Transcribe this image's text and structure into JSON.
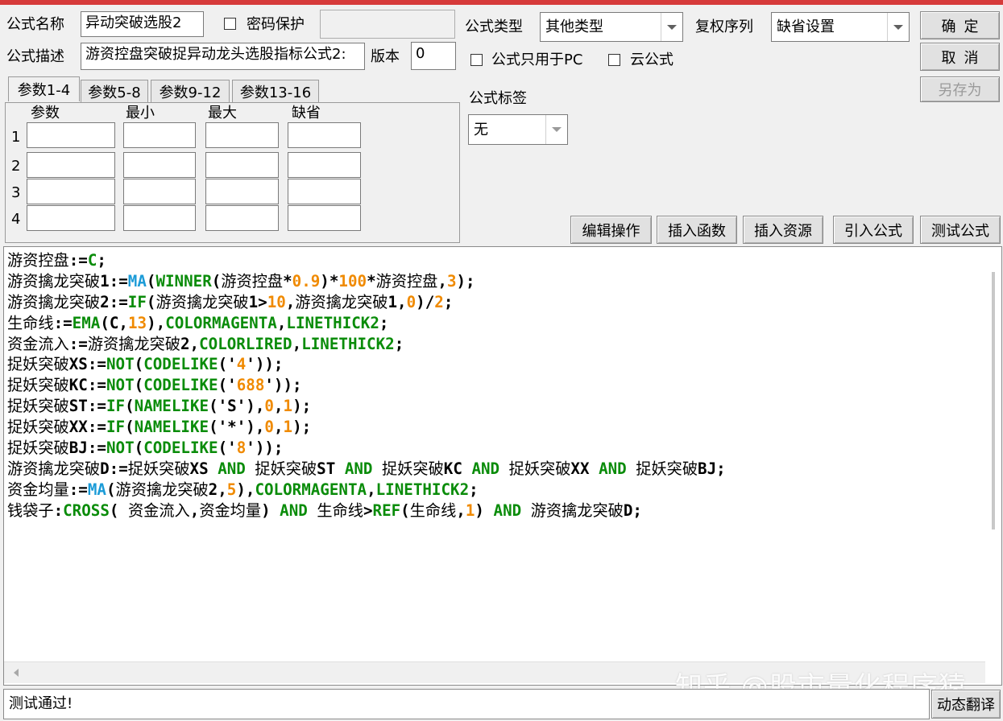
{
  "formula_name": {
    "label": "公式名称",
    "value": "异动突破选股2"
  },
  "password": {
    "label": "密码保护",
    "value": ""
  },
  "formula_type": {
    "label": "公式类型",
    "value": "其他类型"
  },
  "rights_seq": {
    "label": "复权序列",
    "value": "缺省设置"
  },
  "formula_desc": {
    "label": "公式描述",
    "value": "游资控盘突破捉异动龙头选股指标公式2:"
  },
  "version": {
    "label": "版本",
    "value": "0"
  },
  "pc_only": {
    "label": "公式只用于PC"
  },
  "cloud": {
    "label": "云公式"
  },
  "buttons": {
    "ok": "确定",
    "cancel": "取消",
    "save_as": "另存为",
    "edit_ops": "编辑操作",
    "insert_func": "插入函数",
    "insert_res": "插入资源",
    "import_formula": "引入公式",
    "test_formula": "测试公式",
    "dynamic_translate": "动态翻译"
  },
  "tabs": [
    "参数1-4",
    "参数5-8",
    "参数9-12",
    "参数13-16"
  ],
  "param_headers": [
    "参数",
    "最小",
    "最大",
    "缺省"
  ],
  "param_rows": [
    "1",
    "2",
    "3",
    "4"
  ],
  "tag": {
    "label": "公式标签",
    "value": "无"
  },
  "code_lines": [
    [
      [
        "v",
        "游资控盘"
      ],
      [
        "o",
        ":="
      ],
      [
        "f",
        "C"
      ],
      [
        "o",
        ";"
      ]
    ],
    [
      [
        "v",
        "游资擒龙突破"
      ],
      [
        "o",
        "1:="
      ],
      [
        "k",
        "MA"
      ],
      [
        "o",
        "("
      ],
      [
        "f",
        "WINNER"
      ],
      [
        "o",
        "("
      ],
      [
        "v",
        "游资控盘"
      ],
      [
        "o",
        "*"
      ],
      [
        "n",
        "0.9"
      ],
      [
        "o",
        ")*"
      ],
      [
        "n",
        "100"
      ],
      [
        "o",
        "*"
      ],
      [
        "v",
        "游资控盘"
      ],
      [
        "o",
        ","
      ],
      [
        "n",
        "3"
      ],
      [
        "o",
        ");"
      ]
    ],
    [
      [
        "v",
        "游资擒龙突破"
      ],
      [
        "o",
        "2:="
      ],
      [
        "f",
        "IF"
      ],
      [
        "o",
        "("
      ],
      [
        "v",
        "游资擒龙突破"
      ],
      [
        "o",
        "1>"
      ],
      [
        "n",
        "10"
      ],
      [
        "o",
        ","
      ],
      [
        "v",
        "游资擒龙突破"
      ],
      [
        "o",
        "1,"
      ],
      [
        "n",
        "0"
      ],
      [
        "o",
        ")/"
      ],
      [
        "n",
        "2"
      ],
      [
        "o",
        ";"
      ]
    ],
    [
      [
        "v",
        "生命线"
      ],
      [
        "o",
        ":="
      ],
      [
        "f",
        "EMA"
      ],
      [
        "o",
        "(C,"
      ],
      [
        "n",
        "13"
      ],
      [
        "o",
        "),"
      ],
      [
        "f",
        "COLORMAGENTA"
      ],
      [
        "o",
        ","
      ],
      [
        "f",
        "LINETHICK2"
      ],
      [
        "o",
        ";"
      ]
    ],
    [
      [
        "v",
        "资金流入"
      ],
      [
        "o",
        ":="
      ],
      [
        "v",
        "游资擒龙突破"
      ],
      [
        "o",
        "2,"
      ],
      [
        "f",
        "COLORLIRED"
      ],
      [
        "o",
        ","
      ],
      [
        "f",
        "LINETHICK2"
      ],
      [
        "o",
        ";"
      ]
    ],
    [
      [
        "v",
        "捉妖突破"
      ],
      [
        "o",
        "XS:="
      ],
      [
        "f",
        "NOT"
      ],
      [
        "o",
        "("
      ],
      [
        "f",
        "CODELIKE"
      ],
      [
        "o",
        "('"
      ],
      [
        "n",
        "4"
      ],
      [
        "o",
        "'));"
      ]
    ],
    [
      [
        "v",
        "捉妖突破"
      ],
      [
        "o",
        "KC:="
      ],
      [
        "f",
        "NOT"
      ],
      [
        "o",
        "("
      ],
      [
        "f",
        "CODELIKE"
      ],
      [
        "o",
        "('"
      ],
      [
        "n",
        "688"
      ],
      [
        "o",
        "'));"
      ]
    ],
    [
      [
        "v",
        "捉妖突破"
      ],
      [
        "o",
        "ST:="
      ],
      [
        "f",
        "IF"
      ],
      [
        "o",
        "("
      ],
      [
        "f",
        "NAMELIKE"
      ],
      [
        "o",
        "('S'),"
      ],
      [
        "n",
        "0"
      ],
      [
        "o",
        ","
      ],
      [
        "n",
        "1"
      ],
      [
        "o",
        ");"
      ]
    ],
    [
      [
        "v",
        "捉妖突破"
      ],
      [
        "o",
        "XX:="
      ],
      [
        "f",
        "IF"
      ],
      [
        "o",
        "("
      ],
      [
        "f",
        "NAMELIKE"
      ],
      [
        "o",
        "('*'),"
      ],
      [
        "n",
        "0"
      ],
      [
        "o",
        ","
      ],
      [
        "n",
        "1"
      ],
      [
        "o",
        ");"
      ]
    ],
    [
      [
        "v",
        "捉妖突破"
      ],
      [
        "o",
        "BJ:="
      ],
      [
        "f",
        "NOT"
      ],
      [
        "o",
        "("
      ],
      [
        "f",
        "CODELIKE"
      ],
      [
        "o",
        "('"
      ],
      [
        "n",
        "8"
      ],
      [
        "o",
        "'));"
      ]
    ],
    [
      [
        "v",
        "游资擒龙突破"
      ],
      [
        "o",
        "D:="
      ],
      [
        "v",
        "捉妖突破"
      ],
      [
        "o",
        "XS "
      ],
      [
        "f",
        "AND"
      ],
      [
        "o",
        " "
      ],
      [
        "v",
        "捉妖突破"
      ],
      [
        "o",
        "ST "
      ],
      [
        "f",
        "AND"
      ],
      [
        "o",
        " "
      ],
      [
        "v",
        "捉妖突破"
      ],
      [
        "o",
        "KC "
      ],
      [
        "f",
        "AND"
      ],
      [
        "o",
        " "
      ],
      [
        "v",
        "捉妖突破"
      ],
      [
        "o",
        "XX "
      ],
      [
        "f",
        "AND"
      ],
      [
        "o",
        " "
      ],
      [
        "v",
        "捉妖突破"
      ],
      [
        "o",
        "BJ;"
      ]
    ],
    [
      [
        "v",
        "资金均量"
      ],
      [
        "o",
        ":="
      ],
      [
        "k",
        "MA"
      ],
      [
        "o",
        "("
      ],
      [
        "v",
        "游资擒龙突破"
      ],
      [
        "o",
        "2,"
      ],
      [
        "n",
        "5"
      ],
      [
        "o",
        "),"
      ],
      [
        "f",
        "COLORMAGENTA"
      ],
      [
        "o",
        ","
      ],
      [
        "f",
        "LINETHICK2"
      ],
      [
        "o",
        ";"
      ]
    ],
    [
      [
        "v",
        "钱袋子"
      ],
      [
        "o",
        ":"
      ],
      [
        "f",
        "CROSS"
      ],
      [
        "o",
        "( "
      ],
      [
        "v",
        "资金流入"
      ],
      [
        "o",
        ","
      ],
      [
        "v",
        "资金均量"
      ],
      [
        "o",
        ") "
      ],
      [
        "f",
        "AND"
      ],
      [
        "o",
        " "
      ],
      [
        "v",
        "生命线"
      ],
      [
        "o",
        ">"
      ],
      [
        "f",
        "REF"
      ],
      [
        "o",
        "("
      ],
      [
        "v",
        "生命线"
      ],
      [
        "o",
        ","
      ],
      [
        "n",
        "1"
      ],
      [
        "o",
        ") "
      ],
      [
        "f",
        "AND"
      ],
      [
        "o",
        " "
      ],
      [
        "v",
        "游资擒龙突破"
      ],
      [
        "o",
        "D;"
      ]
    ]
  ],
  "status_text": "测试通过!",
  "watermark": "知乎 @股市量化程序猿",
  "colors": {
    "function": "#0a8c0a",
    "number": "#f08a00",
    "keyword_ma": "#1b9bd7",
    "titlebar": "#d63a3a"
  }
}
